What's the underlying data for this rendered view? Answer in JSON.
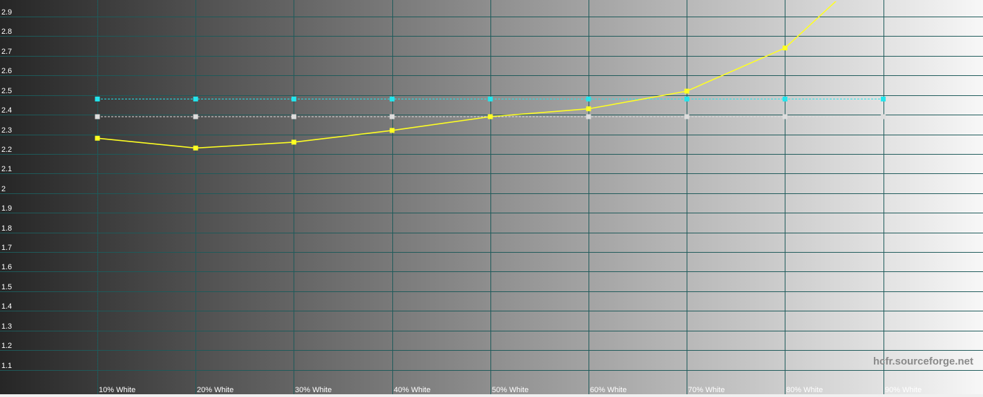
{
  "chart_data": {
    "type": "line",
    "title": "",
    "xlabel": "",
    "ylabel": "",
    "categories": [
      "10% White",
      "20% White",
      "30% White",
      "40% White",
      "50% White",
      "60% White",
      "70% White",
      "80% White",
      "90% White"
    ],
    "y_ticks": [
      "2.9",
      "2.8",
      "2.7",
      "2.6",
      "2.5",
      "2.4",
      "2.3",
      "2.2",
      "2.1",
      "2",
      "1.9",
      "1.8",
      "1.7",
      "1.6",
      "1.5",
      "1.4",
      "1.3",
      "1.2",
      "1.1"
    ],
    "ylim": [
      1.0,
      3.0
    ],
    "grid": true,
    "legend": "none",
    "series": [
      {
        "values": [
          2.28,
          2.23,
          2.26,
          2.32,
          2.39,
          2.43,
          2.52,
          2.74,
          3.2
        ],
        "color": "#ffff22",
        "style": "solid"
      },
      {
        "values": [
          2.48,
          2.48,
          2.48,
          2.48,
          2.48,
          2.48,
          2.48,
          2.48,
          2.48
        ],
        "color": "#22e6ee",
        "style": "dashed"
      },
      {
        "values": [
          2.39,
          2.39,
          2.39,
          2.39,
          2.39,
          2.39,
          2.39,
          2.39,
          2.39
        ],
        "color": "#dddddd",
        "style": "dashed"
      }
    ]
  },
  "watermark": "hcfr.sourceforge.net",
  "colors": {
    "grid": "#1e5a5a",
    "bg_dark": "#262626",
    "bg_light": "#f7f7f7"
  }
}
